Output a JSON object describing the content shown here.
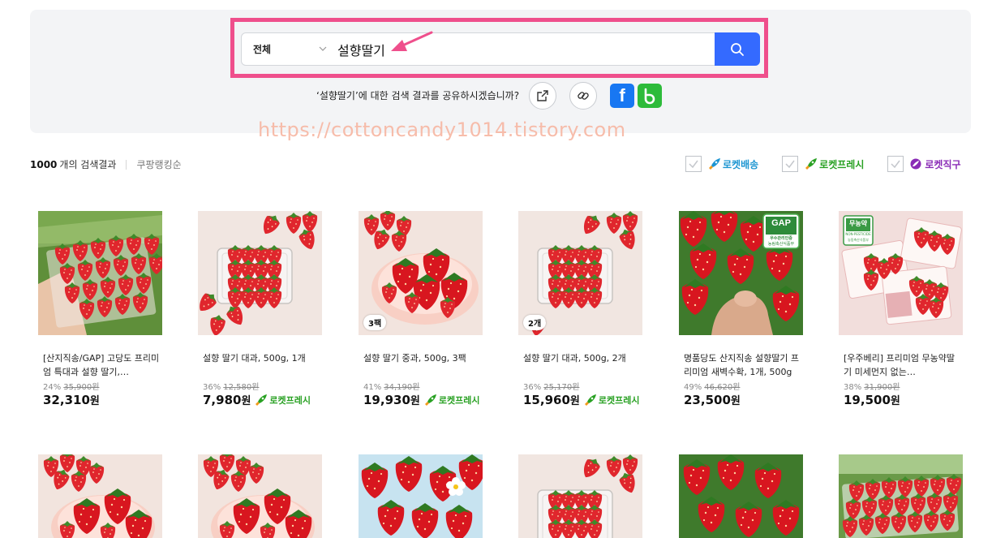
{
  "colors": {
    "accent": "#346aff",
    "highlight": "#ef4f8c",
    "rocket_delivery": "#1e96d2",
    "rocket_fresh": "#29a123",
    "rocket_global": "#8a2bb6"
  },
  "search": {
    "category": "전체",
    "query": "설향딸기",
    "button_icon": "search-icon"
  },
  "share": {
    "prompt": "‘설향딸기’에 대한 검색 결과를 공유하시겠습니까?",
    "facebook_glyph": "f"
  },
  "watermark": "https://cottoncandy1014.tistory.com",
  "results": {
    "count": "1000",
    "count_suffix": "개의 검색결과",
    "sort": "쿠팡랭킹순"
  },
  "filters": [
    {
      "label": "로켓배송",
      "icon": "rocket-delivery-icon"
    },
    {
      "label": "로켓프레시",
      "icon": "rocket-fresh-icon"
    },
    {
      "label": "로켓직구",
      "icon": "rocket-global-icon"
    }
  ],
  "products": [
    {
      "title": "[산지직송/GAP] 고당도 프리미엄 특대과 설향 딸기,…",
      "discount": "24%",
      "original": "35,900원",
      "price": "32,310",
      "won": "원",
      "badge": "",
      "rocket": ""
    },
    {
      "title": "설향 딸기 대과, 500g, 1개",
      "discount": "36%",
      "original": "12,580원",
      "price": "7,980",
      "won": "원",
      "badge": "",
      "rocket": "로켓프레시"
    },
    {
      "title": "설향 딸기 중과, 500g, 3팩",
      "discount": "41%",
      "original": "34,190원",
      "price": "19,930",
      "won": "원",
      "badge": "3팩",
      "rocket": "로켓프레시"
    },
    {
      "title": "설향 딸기 대과, 500g, 2개",
      "discount": "36%",
      "original": "25,170원",
      "price": "15,960",
      "won": "원",
      "badge": "2개",
      "rocket": "로켓프레시"
    },
    {
      "title": "명품당도 산지직송 설향딸기 프리미엄 새벽수확, 1개, 500g",
      "discount": "49%",
      "original": "46,620원",
      "price": "23,500",
      "won": "원",
      "badge": "",
      "rocket": ""
    },
    {
      "title": "[우주베리] 프리미엄 무농약딸기 미세먼지 없는…",
      "discount": "38%",
      "original": "31,900원",
      "price": "19,500",
      "won": "원",
      "badge": "",
      "rocket": ""
    }
  ],
  "thumb_labels": {
    "gap_title": "GAP",
    "gap_sub": "우수관리인증",
    "gap_org": "농림축산식품부",
    "organic_title": "무농약",
    "organic_sub": "NON-PESTICIDE",
    "organic_org": "농림축산식품부"
  }
}
